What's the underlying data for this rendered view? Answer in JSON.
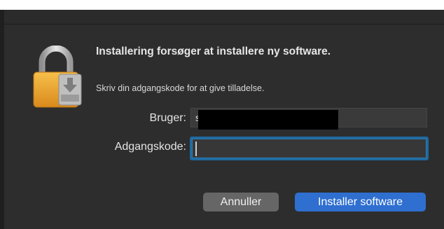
{
  "dialog": {
    "title": "Installering forsøger at installere ny software.",
    "message": "Skriv din adgangskode for at give tilladelse.",
    "user_label": "Bruger:",
    "user_value": "s                                                    n",
    "password_label": "Adgangskode:",
    "password_value": "",
    "cancel_label": "Annuller",
    "install_label": "Installer software"
  },
  "icons": {
    "lock": "lock-icon",
    "installer": "installer-disk-icon"
  },
  "colors": {
    "accent": "#2f6fd0",
    "focus_ring": "#1f6aa0",
    "background": "#2d2d2d",
    "lock_gold": "#f1a82d"
  }
}
